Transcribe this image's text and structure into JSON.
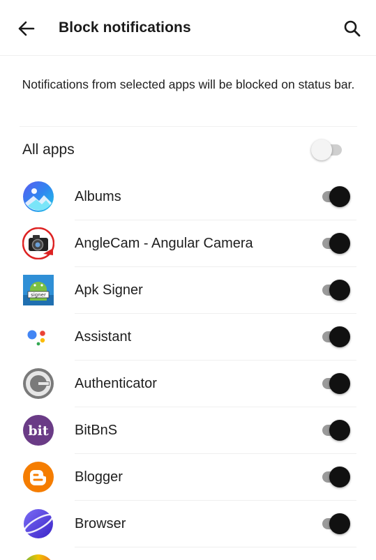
{
  "header": {
    "title": "Block notifications",
    "back_icon": "arrow-left-icon",
    "search_icon": "search-icon"
  },
  "description": "Notifications from selected apps will be blocked on status bar.",
  "all_apps": {
    "label": "All apps",
    "enabled": false
  },
  "apps": [
    {
      "name": "Albums",
      "icon": "albums-icon",
      "blocked": true
    },
    {
      "name": "AngleCam - Angular Camera",
      "icon": "anglecam-icon",
      "blocked": true
    },
    {
      "name": "Apk Signer",
      "icon": "apk-signer-icon",
      "blocked": true
    },
    {
      "name": "Assistant",
      "icon": "assistant-icon",
      "blocked": true
    },
    {
      "name": "Authenticator",
      "icon": "authenticator-icon",
      "blocked": true
    },
    {
      "name": "BitBnS",
      "icon": "bitbns-icon",
      "icon_text": "bit",
      "blocked": true
    },
    {
      "name": "Blogger",
      "icon": "blogger-icon",
      "blocked": true
    },
    {
      "name": "Browser",
      "icon": "browser-icon",
      "blocked": true
    }
  ],
  "colors": {
    "toggle_on_thumb": "#111111",
    "toggle_on_track": "#9a9a9a",
    "toggle_off_track": "#cfcfcf",
    "bitbns_purple": "#6a3b86",
    "blogger_orange": "#f57d00",
    "browser_purple": "#5a3fd8",
    "albums_blue": "#2f86f0"
  }
}
